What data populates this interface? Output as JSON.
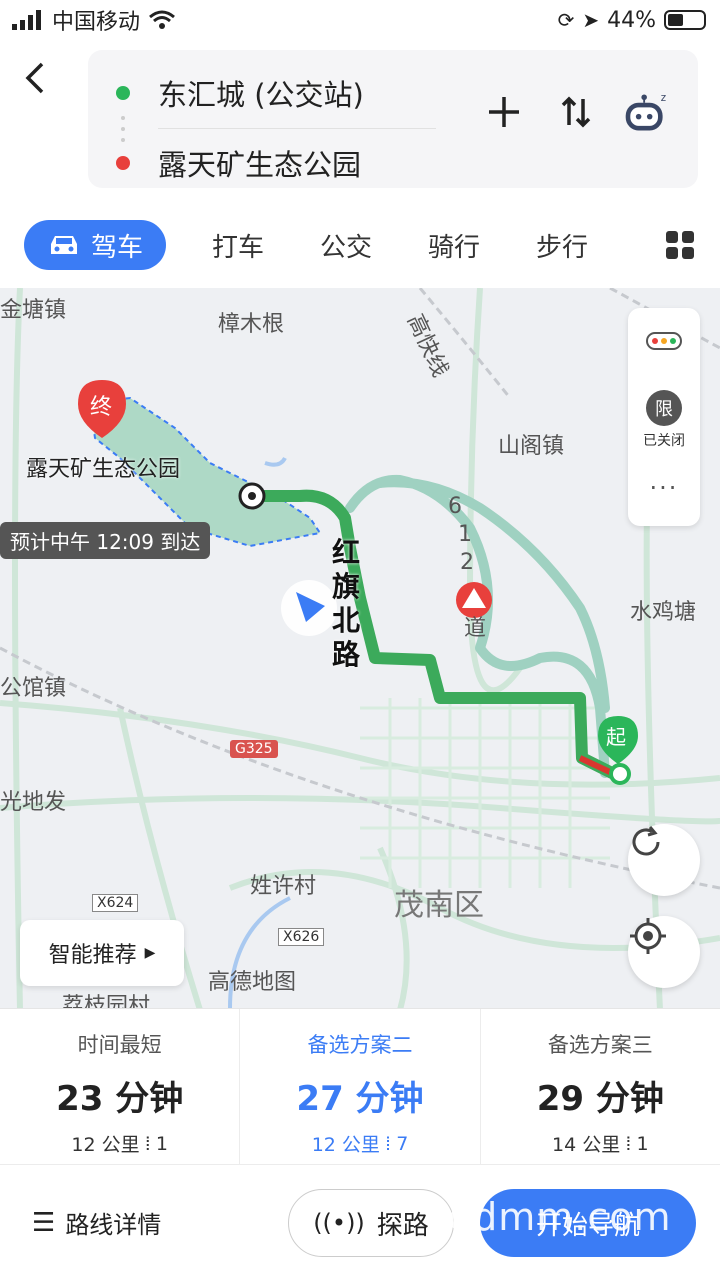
{
  "status": {
    "carrier": "中国移动",
    "battery": "44%",
    "battery_level": 0.44
  },
  "route": {
    "from": "东汇城 (公交站)",
    "to": "露天矿生态公园",
    "from_color": "#2bb65a",
    "to_color": "#e8403c"
  },
  "modes": {
    "active": "驾车",
    "items": [
      "打车",
      "公交",
      "骑行",
      "步行"
    ]
  },
  "map": {
    "labels": {
      "town_jintang": "金塘镇",
      "zhangmugen": "樟木根",
      "gaokuai": "高快线",
      "shange": "山阁镇",
      "shuijitang": "水鸡塘",
      "gongguan": "公馆镇",
      "guangdifa": "光地发",
      "xingxucun": "姓许村",
      "maonan": "茂南区",
      "gaode": "高德地图",
      "lizhiyuancun": "荔枝园村",
      "g325": "G325",
      "x624": "X624",
      "x626": "X626",
      "road_612": [
        "6",
        "1",
        "2"
      ],
      "road_612_end": "道"
    },
    "destination_name": "露天矿生态公园",
    "dest_marker": "终",
    "start_marker": "起",
    "eta": "预计中午 12:09 到达",
    "road_name": [
      "红",
      "旗",
      "北",
      "路"
    ],
    "side_panel": {
      "limit_char": "限",
      "limit_status": "已关闭"
    },
    "smart_recommend": "智能推荐",
    "route_color": "#3caa5b",
    "alt_route_color": "#9fd1c1"
  },
  "plans": [
    {
      "label": "时间最短",
      "time": "23 分钟",
      "distance": "12 公里",
      "lights": "1"
    },
    {
      "label": "备选方案二",
      "time": "27 分钟",
      "distance": "12 公里",
      "lights": "7"
    },
    {
      "label": "备选方案三",
      "time": "29 分钟",
      "distance": "14 公里",
      "lights": "1"
    }
  ],
  "bottom": {
    "detail": "路线详情",
    "explore": "探路",
    "start": "开始导航",
    "watermark": "gdmm.com"
  }
}
